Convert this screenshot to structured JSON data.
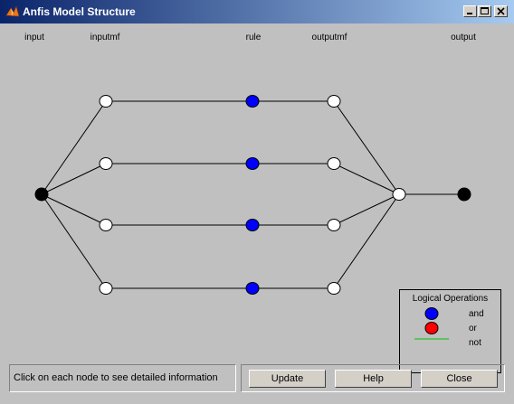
{
  "window": {
    "title": "Anfis Model Structure",
    "icon": "matlab-icon",
    "controls": {
      "minimize": "minimize-icon",
      "maximize": "maximize-icon",
      "close": "close-icon"
    }
  },
  "diagram": {
    "columns": {
      "input": "input",
      "inputmf": "inputmf",
      "rule": "rule",
      "outputmf": "outputmf",
      "output": "output"
    },
    "node_colors": {
      "input": "#000000",
      "inputmf": "#ffffff",
      "rule": "#0000ff",
      "outputmf": "#ffffff",
      "sum": "#ffffff",
      "output": "#000000"
    },
    "rule_count": 4
  },
  "legend": {
    "title": "Logical Operations",
    "items": [
      {
        "label": "and",
        "color": "#0000ff",
        "shape": "circle"
      },
      {
        "label": "or",
        "color": "#ff0000",
        "shape": "circle"
      },
      {
        "label": "not",
        "color": "#00c000",
        "shape": "line"
      }
    ]
  },
  "status": {
    "text": "Click on each node to see detailed information"
  },
  "buttons": {
    "update": "Update",
    "help": "Help",
    "close": "Close"
  }
}
